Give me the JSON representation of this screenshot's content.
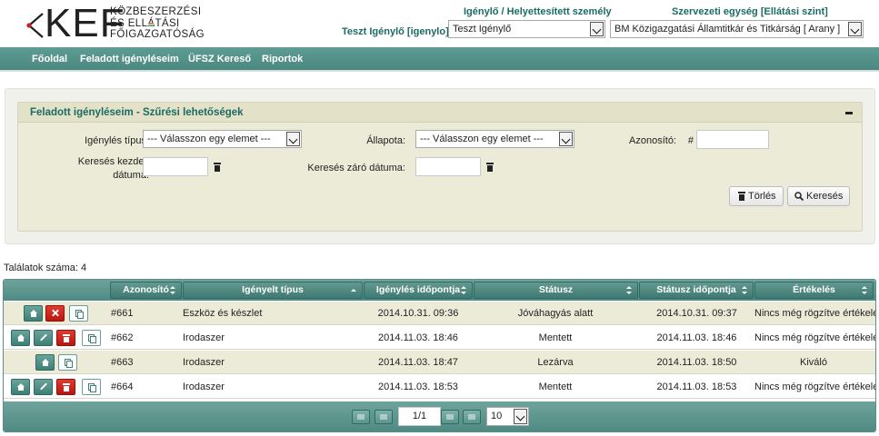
{
  "header": {
    "logo_letters": "KEF",
    "logo_lines": [
      "KÖZBESZERZÉSI",
      "ÉS ELLÁTÁSI",
      "FŐIGAZGATÓSÁG"
    ],
    "user_label": "Teszt Igénylő [igenylo]",
    "requester_label": "Igénylő / Helyettesített személy",
    "requester_value": "Teszt Igénylő",
    "unit_label": "Szervezeti egység [Ellátási szint]",
    "unit_value": "BM Közigazgatási Államtitkár és Titkárság [ Arany ]"
  },
  "nav": {
    "home": "Főoldal",
    "my_requests": "Feladott igényléseim",
    "ufsz_search": "ÜFSZ Kereső",
    "reports": "Riportok"
  },
  "filter": {
    "title": "Feladott igényléseim - Szűrési lehetőségek",
    "type_label": "Igénylés típus:",
    "type_value": "--- Válasszon egy elemet ---",
    "state_label": "Állapota:",
    "state_value": "--- Válasszon egy elemet ---",
    "id_label": "Azonosító:",
    "id_prefix": "#",
    "start_label_1": "Keresés kezdeti",
    "start_label_2": "dátuma:",
    "end_label": "Keresés záró dátuma:",
    "clear_button": "Törlés",
    "search_button": "Keresés"
  },
  "results": {
    "count_label": "Találatok száma:",
    "count": "4"
  },
  "table": {
    "columns": [
      "Azonosító",
      "Igényelt típus",
      "Igénylés időpontja",
      "Státusz",
      "Státusz időpontja",
      "Értékelés"
    ],
    "rows": [
      {
        "id": "#661",
        "type": "Eszköz és készlet",
        "date": "2014.10.31. 09:36",
        "status": "Jóváhagyás alatt",
        "status_date": "2014.10.31. 09:37",
        "evaluation": "Nincs még rögzítve értékelés",
        "actions": [
          "home",
          "reject",
          "copy"
        ]
      },
      {
        "id": "#662",
        "type": "Irodaszer",
        "date": "2014.11.03. 18:46",
        "status": "Mentett",
        "status_date": "2014.11.03. 18:46",
        "evaluation": "Nincs még rögzítve értékelés",
        "actions": [
          "home",
          "edit",
          "delete",
          "copy"
        ]
      },
      {
        "id": "#663",
        "type": "Irodaszer",
        "date": "2014.11.03. 18:47",
        "status": "Lezárva",
        "status_date": "2014.11.03. 18:50",
        "evaluation": "Kiváló",
        "actions": [
          "home",
          "copy"
        ]
      },
      {
        "id": "#664",
        "type": "Irodaszer",
        "date": "2014.11.03. 18:53",
        "status": "Mentett",
        "status_date": "2014.11.03. 18:53",
        "evaluation": "Nincs még rögzítve értékelés",
        "actions": [
          "home",
          "edit",
          "delete",
          "copy"
        ]
      }
    ]
  },
  "pager": {
    "page": "1/1",
    "page_size": "10"
  },
  "colors": {
    "accent": "#1a6b63",
    "nav_bg": "#5f9c93",
    "panel_bg": "#ecebd8",
    "delete_red": "#c8201a"
  }
}
